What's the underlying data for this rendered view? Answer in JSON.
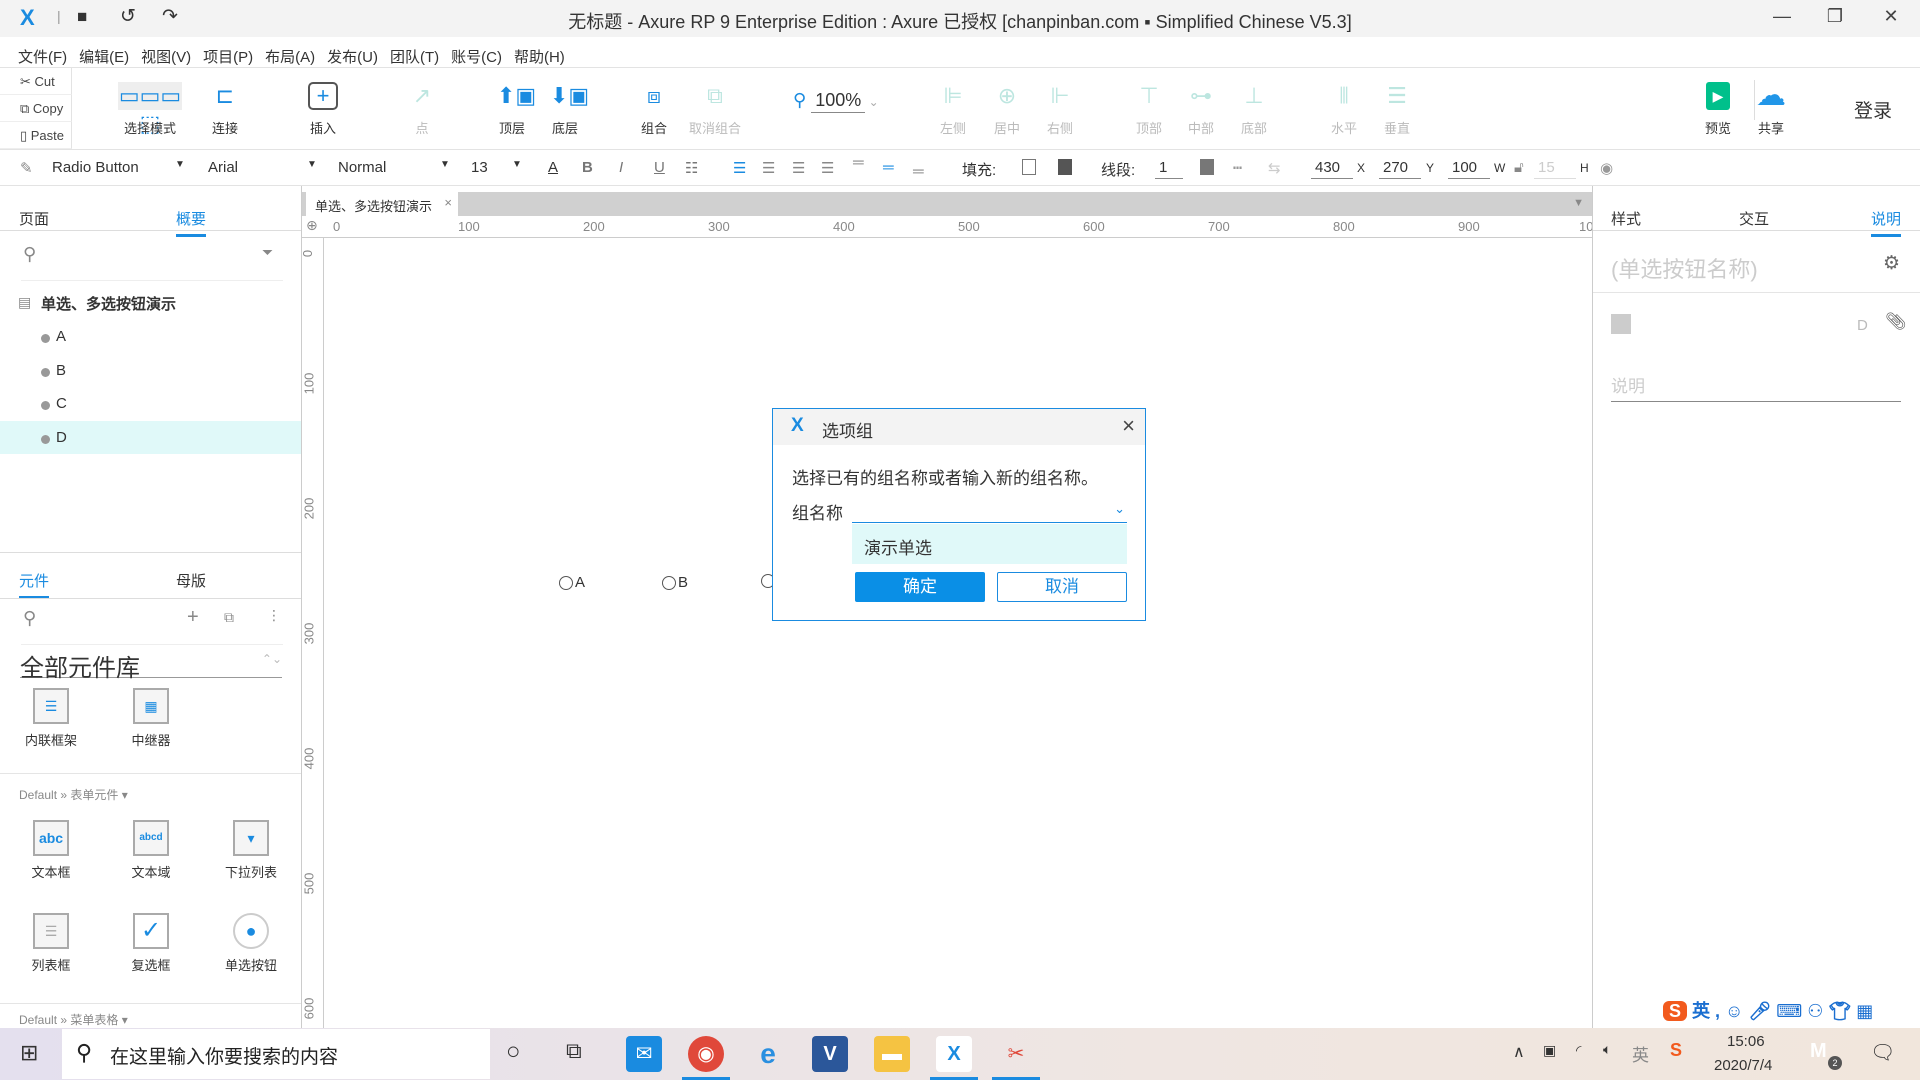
{
  "window": {
    "title": "无标题 - Axure RP 9 Enterprise Edition : Axure 已授权    [chanpinban.com ▪ Simplified Chinese V5.3]",
    "minimize": "—",
    "restore": "❐",
    "close": "✕"
  },
  "menu": [
    "文件(F)",
    "编辑(E)",
    "视图(V)",
    "项目(P)",
    "布局(A)",
    "发布(U)",
    "团队(T)",
    "账号(C)",
    "帮助(H)"
  ],
  "clipboard": {
    "cut": "Cut",
    "copy": "Copy",
    "paste": "Paste"
  },
  "toolbar": {
    "select_mode": "选择模式",
    "connect": "连接",
    "insert": "插入",
    "point": "点",
    "top_layer": "顶层",
    "bottom_layer": "底层",
    "group": "组合",
    "ungroup": "取消组合",
    "zoom": "100%",
    "align_left": "左侧",
    "align_center": "居中",
    "align_right": "右侧",
    "align_top": "顶部",
    "align_middle": "中部",
    "align_bottom": "底部",
    "distribute_h": "水平",
    "distribute_v": "垂直",
    "preview": "预览",
    "share": "共享",
    "login": "登录"
  },
  "format": {
    "widget_type": "Radio Button",
    "font": "Arial",
    "style": "Normal",
    "size": "13",
    "fill_label": "填充:",
    "stroke_label": "线段:",
    "stroke_width": "1",
    "x": "430",
    "x_label": "X",
    "y": "270",
    "y_label": "Y",
    "w": "100",
    "w_label": "W",
    "h": "15",
    "h_label": "H"
  },
  "left": {
    "tabs": [
      "页面",
      "概要"
    ],
    "active_tab": "概要",
    "outline": {
      "page": "单选、多选按钮演示",
      "items": [
        "A",
        "B",
        "C",
        "D"
      ],
      "selected": "D"
    },
    "lib_tabs": [
      "元件",
      "母版"
    ],
    "active_lib_tab": "元件",
    "library": "全部元件库",
    "top_widgets": [
      "内联框架",
      "中继器"
    ],
    "section1": "Default » 表单元件 ▾",
    "form_widgets": [
      "文本框",
      "文本域",
      "下拉列表",
      "列表框",
      "复选框",
      "单选按钮"
    ],
    "section2": "Default » 菜单表格 ▾"
  },
  "canvas": {
    "tab": "单选、多选按钮演示",
    "hruler": [
      "0",
      "100",
      "200",
      "300",
      "400",
      "500",
      "600",
      "700",
      "800",
      "900",
      "10"
    ],
    "vruler": [
      "0",
      "100",
      "200",
      "300",
      "400",
      "500",
      "600"
    ],
    "radios": [
      "A",
      "B",
      ""
    ]
  },
  "dialog": {
    "title": "选项组",
    "prompt": "选择已有的组名称或者输入新的组名称。",
    "field_label": "组名称",
    "field_value": "",
    "option": "演示单选",
    "ok": "确定",
    "cancel": "取消"
  },
  "right": {
    "tabs": [
      "样式",
      "交互",
      "说明"
    ],
    "active_tab": "说明",
    "name_placeholder": "(单选按钮名称)",
    "field_letter": "D",
    "notes_placeholder": "说明"
  },
  "taskbar": {
    "search_placeholder": "在这里输入你要搜索的内容",
    "time": "15:06",
    "date": "2020/7/4",
    "ime": "英",
    "badge": "2"
  },
  "colors": {
    "accent": "#1a8be0",
    "selected_row": "#e0f9f9",
    "preview_green": "#00c08b"
  }
}
